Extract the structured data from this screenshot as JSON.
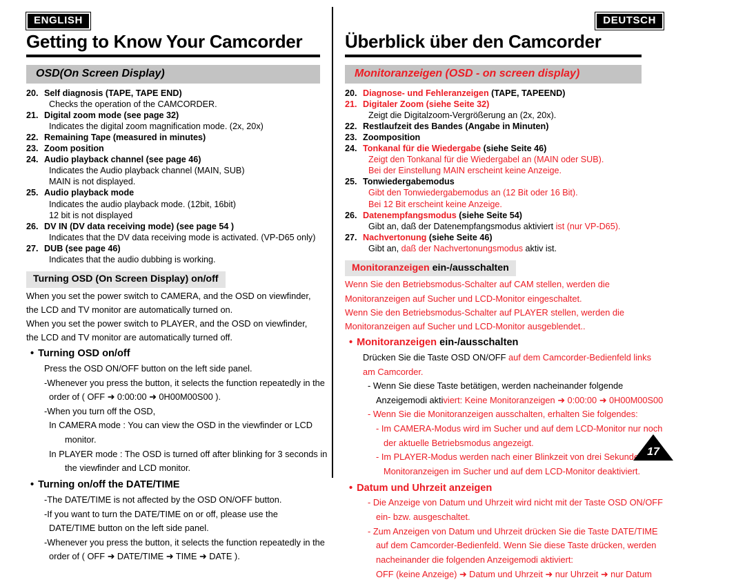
{
  "page": {
    "number": "17",
    "divider": true
  },
  "english": {
    "language_badge": "ENGLISH",
    "chapter_title": "Getting to Know Your Camcorder",
    "section_band": "OSD(On Screen Display)",
    "items": [
      {
        "num": "20.",
        "head": "Self diagnosis (TAPE, TAPE END)",
        "subs": [
          "Checks the operation of the CAMCORDER."
        ]
      },
      {
        "num": "21.",
        "head": "Digital zoom mode (see page 32)",
        "subs": [
          "Indicates the digital zoom magnification mode. (2x, 20x)"
        ]
      },
      {
        "num": "22.",
        "head": "Remaining Tape (measured in minutes)",
        "subs": []
      },
      {
        "num": "23.",
        "head": "Zoom position",
        "subs": []
      },
      {
        "num": "24.",
        "head": "Audio playback channel (see page 46)",
        "subs": [
          "Indicates the Audio playback channel (MAIN, SUB)",
          "MAIN is not displayed."
        ]
      },
      {
        "num": "25.",
        "head": "Audio playback mode",
        "subs": [
          "Indicates the audio playback mode. (12bit, 16bit)",
          "12 bit is not displayed"
        ]
      },
      {
        "num": "26.",
        "head": "DV IN (DV data receiving mode) (see page 54 )",
        "subs": [
          "Indicates that the DV data receiving mode is activated. (VP-D65 only)"
        ]
      },
      {
        "num": "27.",
        "head": "DUB (see page 46)",
        "subs": [
          "Indicates that the audio dubbing is working."
        ]
      }
    ],
    "sub_band": "Turning OSD (On Screen Display) on/off",
    "intro": [
      "When you set the power switch to CAMERA, and the OSD on viewfinder,",
      "the LCD and TV monitor are automatically turned on.",
      "When you set the power switch to PLAYER, and the OSD on viewfinder,",
      "the LCD and TV monitor are automatically turned off."
    ],
    "bullet1": {
      "title": "Turning OSD on/off",
      "lines": [
        {
          "indent": 1,
          "text": "Press the OSD ON/OFF button on the left side panel."
        },
        {
          "indent": 1,
          "text": "-Whenever you press the button, it selects the function repeatedly in the"
        },
        {
          "indent": 2,
          "text": "order of ( OFF ➜ 0:00:00 ➜  0H00M00S00 )."
        },
        {
          "indent": 1,
          "text": "-When you turn off the OSD,"
        },
        {
          "indent": 2,
          "text": "In CAMERA mode : You can view the OSD in the viewfinder or LCD"
        },
        {
          "indent": 4,
          "text": "monitor."
        },
        {
          "indent": 2,
          "text": "In PLAYER mode  : The OSD is turned off after blinking for 3 seconds in"
        },
        {
          "indent": 4,
          "text": "the viewfinder and LCD monitor."
        }
      ]
    },
    "bullet2": {
      "title": "Turning on/off the DATE/TIME",
      "lines": [
        {
          "indent": 1,
          "text": "-The DATE/TIME is not affected by the OSD ON/OFF button."
        },
        {
          "indent": 1,
          "text": "-If you want to turn the DATE/TIME on or off, please use the"
        },
        {
          "indent": 2,
          "text": "DATE/TIME button on the left side panel."
        },
        {
          "indent": 1,
          "text": "-Whenever you press the button, it selects the function repeatedly in the"
        },
        {
          "indent": 2,
          "text": "order of ( OFF ➜ DATE/TIME ➜  TIME ➜  DATE )."
        }
      ]
    }
  },
  "german": {
    "language_badge": "DEUTSCH",
    "chapter_title": "Überblick über den Camcorder",
    "section_band": "Monitoranzeigen (OSD - on screen display)",
    "items": [
      {
        "num": "20.",
        "head_red": "Diagnose- und Fehleranzeigen",
        "head_blk": " (TAPE, TAPEEND)",
        "subs": []
      },
      {
        "num": "21.",
        "head_red": "Digitaler Zoom (siehe Seite 32)",
        "head_blk": "",
        "num_red": true,
        "subs": [
          {
            "color": "blk",
            "text": "Zeigt die Digitalzoom-Vergrößerung an (2x, 20x)."
          }
        ]
      },
      {
        "num": "22.",
        "head_red": "",
        "head_blk": "Restlaufzeit des Bandes (Angabe in Minuten)",
        "subs": []
      },
      {
        "num": "23.",
        "head_red": "",
        "head_blk": "Zoomposition",
        "no_space": true,
        "subs": []
      },
      {
        "num": "24.",
        "head_red": "Tonkanal für die Wiedergabe",
        "head_blk": " (siehe Seite 46)",
        "subs": [
          {
            "color": "red",
            "text": "Zeigt den Tonkanal für die Wiedergabel an (MAIN oder SUB)."
          },
          {
            "color": "red",
            "text": "Bei der Einstellung MAIN erscheint keine Anzeige."
          }
        ]
      },
      {
        "num": "25.",
        "head_red": "",
        "head_blk": "Tonwiedergabemodus",
        "subs": [
          {
            "color": "red",
            "text": "Gibt den Tonwiedergabemodus an (12 Bit oder 16 Bit)."
          },
          {
            "color": "red",
            "text": "Bei 12 Bit erscheint keine Anzeige."
          }
        ]
      },
      {
        "num": "26.",
        "head_red": "Datenempfangsmodus",
        "head_blk": " (siehe Seite 54)",
        "subs": [
          {
            "color": "mix1",
            "text": "Gibt an, daß der Datenempfangsmodus aktiviert ",
            "text2": "ist (nur VP-D65)."
          }
        ]
      },
      {
        "num": "27.",
        "head_red": "Nachvertonung",
        "head_blk": " (siehe Seite 46)",
        "subs": [
          {
            "color": "mix2",
            "text": "Gibt an, ",
            "text2": "daß der Nachvertonungsmodus ",
            "text3": "aktiv ist."
          }
        ]
      }
    ],
    "sub_band_red": "Monitoranzeigen",
    "sub_band_blk": " ein-/ausschalten",
    "intro": [
      "Wenn Sie den Betriebsmodus-Schalter auf CAM stellen, werden die",
      "Monitoranzeigen auf Sucher und LCD-Monitor eingeschaltet.",
      "Wenn Sie den Betriebsmodus-Schalter auf PLAYER stellen, werden die",
      "Monitoranzeigen auf Sucher und LCD-Monitor ausgeblendet.."
    ],
    "bullet1": {
      "title_red": "Monitoranzeigen",
      "title_blk": " ein-/ausschalten",
      "lines": [
        {
          "indent": 1,
          "blk": "Drücken Sie die Taste OSD ON/OFF ",
          "red": "auf dem Camcorder-Bedienfeld links"
        },
        {
          "indent": 1,
          "blk": "",
          "red": "am Camcorder."
        },
        {
          "indent": 2,
          "blk": "-  Wenn Sie diese Taste betätigen, werden nacheinander folgende",
          "red": ""
        },
        {
          "indent": 3,
          "blk": "Anzeigemodi akti",
          "red": "viert: Keine Monitoranzeigen ➜ 0:00:00 ➜ 0H00M00S00"
        },
        {
          "indent": 2,
          "blk": "",
          "red": "-  Wenn Sie die Monitoranzeigen ausschalten, erhalten Sie folgendes:"
        },
        {
          "indent": 3,
          "blk": "",
          "red": "-  Im CAMERA-Modus wird im Sucher und auf dem LCD-Monitor nur noch"
        },
        {
          "indent": 4,
          "blk": "",
          "red": "der aktuelle Betriebsmodus angezeigt."
        },
        {
          "indent": 3,
          "blk": "",
          "red": "-  Im PLAYER-Modus werden nach einer Blinkzeit von drei Sekunden die"
        },
        {
          "indent": 4,
          "blk": "",
          "red": "Monitoranzeigen im Sucher und auf dem LCD-Monitor deaktiviert."
        }
      ]
    },
    "bullet2": {
      "title_red": "Datum und Uhrzeit anzeigen",
      "lines": [
        {
          "indent": 2,
          "red": "-  Die Anzeige von Datum und Uhrzeit wird nicht mit der Taste OSD ON/OFF"
        },
        {
          "indent": 3,
          "red": "ein- bzw. ausgeschaltet."
        },
        {
          "indent": 2,
          "red": "-  Zum Anzeigen von Datum und Uhrzeit drücken Sie die Taste DATE/TIME"
        },
        {
          "indent": 3,
          "red": "auf dem Camcorder-Bedienfeld. Wenn Sie diese Taste drücken, werden"
        },
        {
          "indent": 3,
          "red": "nacheinander die folgenden Anzeigemodi aktiviert:"
        },
        {
          "indent": 3,
          "red": "OFF (keine Anzeige) ➜ Datum und Uhrzeit ➜ nur Uhrzeit ➜ nur Datum"
        }
      ]
    }
  }
}
